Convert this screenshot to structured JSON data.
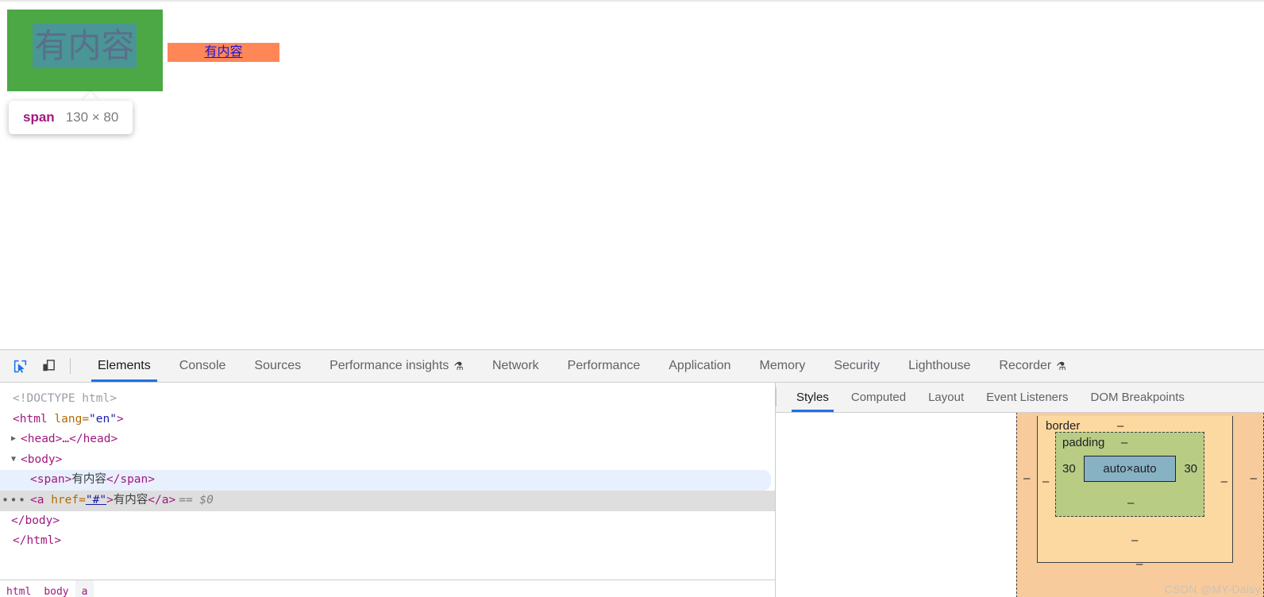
{
  "page": {
    "span_text": "有内容",
    "link_text": "有内容",
    "tooltip": {
      "tag": "span",
      "size": "130 × 80"
    },
    "colors": {
      "padding_overlay": "#4ca845",
      "content_overlay": "#4a9595",
      "link_background": "#ff8656",
      "link_color": "#1414e6"
    }
  },
  "devtools": {
    "toolbar_icons": [
      {
        "name": "inspect-element-icon",
        "active": true
      },
      {
        "name": "device-toolbar-icon",
        "active": false
      }
    ],
    "tabs": [
      {
        "label": "Elements",
        "active": true,
        "flask": false
      },
      {
        "label": "Console",
        "active": false,
        "flask": false
      },
      {
        "label": "Sources",
        "active": false,
        "flask": false
      },
      {
        "label": "Performance insights",
        "active": false,
        "flask": true
      },
      {
        "label": "Network",
        "active": false,
        "flask": false
      },
      {
        "label": "Performance",
        "active": false,
        "flask": false
      },
      {
        "label": "Application",
        "active": false,
        "flask": false
      },
      {
        "label": "Memory",
        "active": false,
        "flask": false
      },
      {
        "label": "Security",
        "active": false,
        "flask": false
      },
      {
        "label": "Lighthouse",
        "active": false,
        "flask": false
      },
      {
        "label": "Recorder",
        "active": false,
        "flask": true
      }
    ],
    "flask_glyph": "⚗",
    "dom": {
      "doctype": "<!DOCTYPE html>",
      "html_open_tag": "<html",
      "html_attr_name": "lang",
      "html_attr_value": "\"en\"",
      "html_open_close": ">",
      "head_line": "<head>…</head>",
      "body_open": "<body>",
      "span_open": "<span>",
      "span_text": "有内容",
      "span_close": "</span>",
      "a_open_start": "<a ",
      "a_attr_name": "href=",
      "a_attr_value": "\"#\"",
      "a_open_end": ">",
      "a_text": "有内容",
      "a_close": "</a>",
      "selected_marker": "== $0",
      "body_close": "</body>",
      "html_close": "</html>",
      "collapsed_triangle": "▶",
      "expanded_triangle": "▼",
      "row_menu": "•••"
    },
    "breadcrumb": [
      "html",
      "body",
      "a"
    ]
  },
  "styles": {
    "tabs": [
      {
        "label": "Styles",
        "active": true
      },
      {
        "label": "Computed",
        "active": false
      },
      {
        "label": "Layout",
        "active": false
      },
      {
        "label": "Event Listeners",
        "active": false
      },
      {
        "label": "DOM Breakpoints",
        "active": false
      }
    ],
    "box_model": {
      "border_label": "border",
      "padding_label": "padding",
      "content_size": "auto×auto",
      "margin_left": "–",
      "margin_right": "–",
      "margin_bottom": "–",
      "border_left": "–",
      "border_right": "–",
      "border_top": "–",
      "border_bottom": "–",
      "padding_left": "30",
      "padding_right": "30",
      "padding_top": "–",
      "padding_bottom": "–"
    }
  },
  "watermark": "CSDN @MY-Daisy"
}
